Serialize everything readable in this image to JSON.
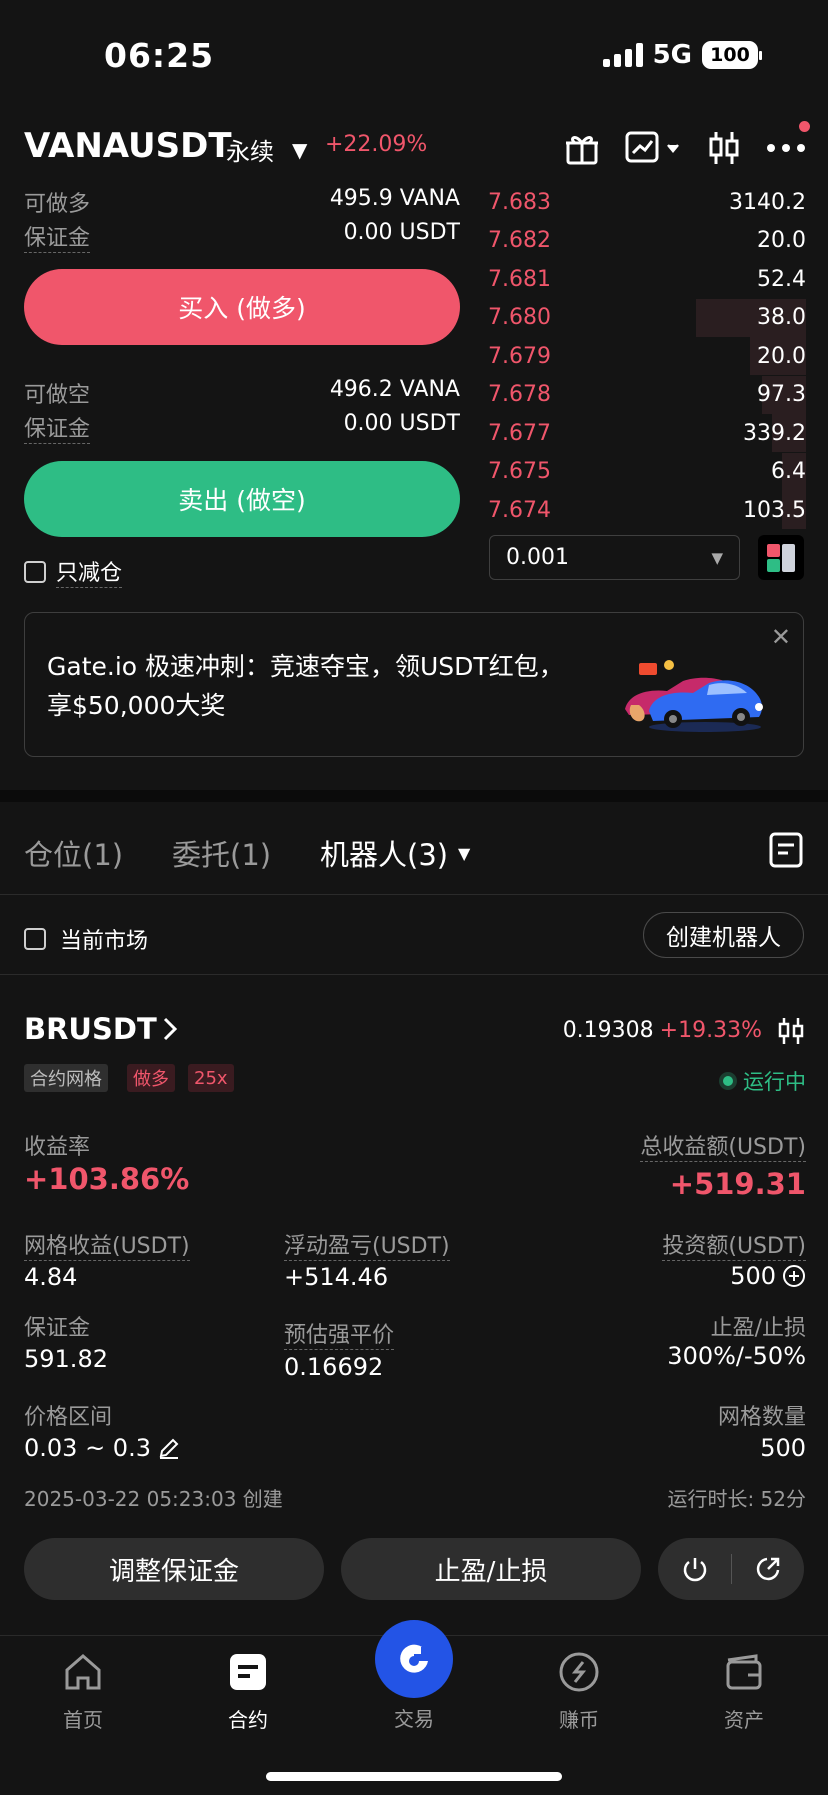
{
  "status": {
    "time": "06:25",
    "network": "5G",
    "battery": "100"
  },
  "header": {
    "pair": "VANAUSDT",
    "contract_type": "永续",
    "change": "+22.09%"
  },
  "trade": {
    "long_available_label": "可做多",
    "long_available_value": "495.9 VANA",
    "long_margin_label": "保证金",
    "long_margin_value": "0.00 USDT",
    "buy_label": "买入 (做多)",
    "short_available_label": "可做空",
    "short_available_value": "496.2 VANA",
    "short_margin_label": "保证金",
    "short_margin_value": "0.00 USDT",
    "sell_label": "卖出 (做空)",
    "reduce_only_label": "只减仓"
  },
  "orderbook": {
    "asks": [
      {
        "price": "7.683",
        "amount": "3140.2",
        "depth": 0.0
      },
      {
        "price": "7.682",
        "amount": "20.0",
        "depth": 0.0
      },
      {
        "price": "7.681",
        "amount": "52.4",
        "depth": 0.0
      },
      {
        "price": "7.680",
        "amount": "38.0",
        "depth": 0.55
      },
      {
        "price": "7.679",
        "amount": "20.0",
        "depth": 0.28
      },
      {
        "price": "7.678",
        "amount": "97.3",
        "depth": 0.22
      },
      {
        "price": "7.677",
        "amount": "339.2",
        "depth": 0.17
      },
      {
        "price": "7.675",
        "amount": "6.4",
        "depth": 0.12
      },
      {
        "price": "7.674",
        "amount": "103.5",
        "depth": 0.12
      }
    ],
    "precision": "0.001"
  },
  "banner": {
    "text": "Gate.io 极速冲刺：竞速夺宝，领USDT红包，享$50,000大奖"
  },
  "tabs": {
    "positions": "仓位(1)",
    "orders": "委托(1)",
    "bots": "机器人(3)"
  },
  "filter": {
    "current_market_label": "当前市场",
    "create_bot_label": "创建机器人"
  },
  "bot": {
    "pair": "BRUSDT",
    "price": "0.19308",
    "change": "+19.33%",
    "tags": [
      "合约网格",
      "做多",
      "25x"
    ],
    "status": "运行中",
    "roi_label": "收益率",
    "roi_value": "+103.86%",
    "total_profit_label": "总收益额(USDT)",
    "total_profit_value": "+519.31",
    "grid_profit_label": "网格收益(USDT)",
    "grid_profit_value": "4.84",
    "floating_pnl_label": "浮动盈亏(USDT)",
    "floating_pnl_value": "+514.46",
    "investment_label": "投资额(USDT)",
    "investment_value": "500",
    "margin_label": "保证金",
    "margin_value": "591.82",
    "liq_price_label": "预估强平价",
    "liq_price_value": "0.16692",
    "tpsl_label": "止盈/止损",
    "tpsl_value": "300%/-50%",
    "range_label": "价格区间",
    "range_value": "0.03 ~ 0.3",
    "grid_count_label": "网格数量",
    "grid_count_value": "500",
    "created": "2025-03-22 05:23:03 创建",
    "runtime": "运行时长: 52分",
    "adjust_margin_label": "调整保证金",
    "tpsl_button_label": "止盈/止损"
  },
  "nav": {
    "home": "首页",
    "contract": "合约",
    "trade": "交易",
    "earn": "赚币",
    "assets": "资产"
  },
  "colors": {
    "up": "#2ebd85",
    "down": "#f0566b",
    "primary": "#2354e6",
    "background": "#141414"
  },
  "icons": [
    "gift-icon",
    "chart-icon",
    "candlestick-icon",
    "more-icon",
    "close-icon",
    "orders-doc-icon",
    "chevron-right-icon",
    "plus-circle-icon",
    "edit-icon",
    "power-icon",
    "share-icon",
    "home-icon",
    "contract-icon",
    "trade-icon",
    "earn-icon",
    "wallet-icon"
  ]
}
